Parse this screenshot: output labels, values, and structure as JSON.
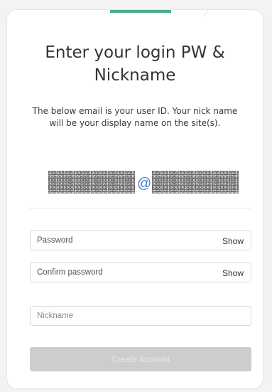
{
  "page": {
    "title": "Enter your login PW & Nickname",
    "subtitle": "The below email is your user ID. Your nick name will be your display name on the site(s)."
  },
  "email": {
    "at_symbol": "@"
  },
  "form": {
    "password_placeholder": "Password",
    "password_show_label": "Show",
    "confirm_placeholder": "Confirm password",
    "confirm_show_label": "Show",
    "nickname_placeholder": "Nickname",
    "submit_label": "Create Account"
  },
  "colors": {
    "accent": "#4aa98f",
    "disabled_button": "#cdcdcd",
    "at_symbol": "#4a7fcf"
  }
}
